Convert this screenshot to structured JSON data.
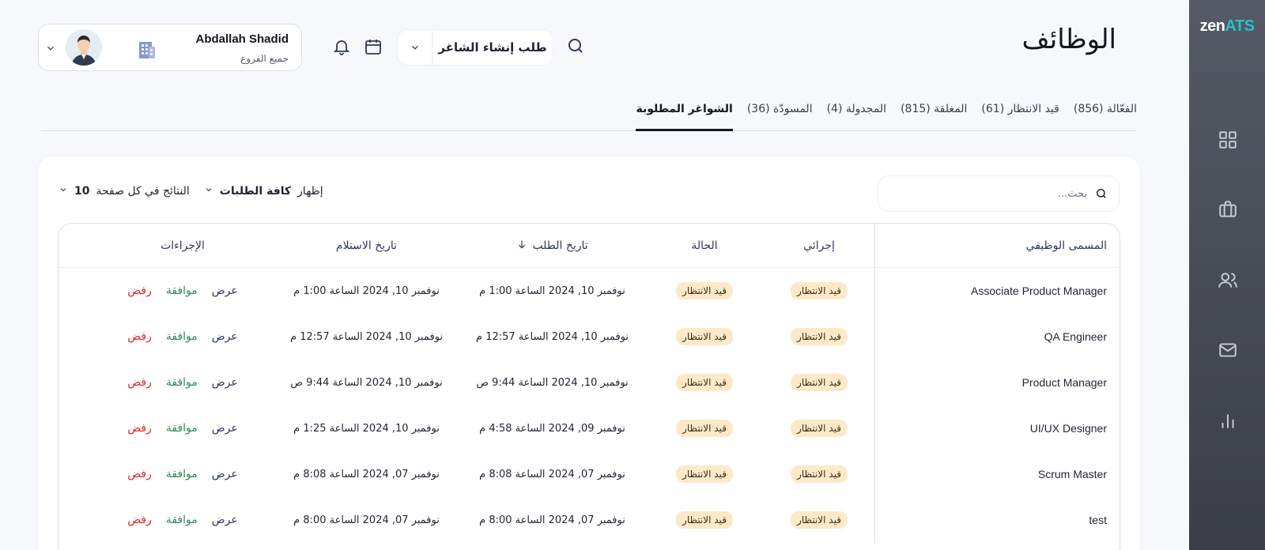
{
  "app": {
    "logo_main": "zen",
    "logo_accent": "ATS",
    "colors": {
      "accent": "#22c3c9",
      "approve": "#2f8a5a",
      "reject": "#e0262a",
      "badge_bg": "#fde9c8"
    }
  },
  "sidebar": {
    "items": [
      {
        "icon": "grid-icon"
      },
      {
        "icon": "briefcase-icon"
      },
      {
        "icon": "users-icon"
      },
      {
        "icon": "mail-icon"
      },
      {
        "icon": "chart-icon"
      }
    ]
  },
  "header": {
    "title": "الوظائف",
    "create_button_label": "طلب إنشاء الشاغر",
    "user": {
      "name": "Abdallah Shadid",
      "branch": "جميع الفروع"
    }
  },
  "tabs": [
    {
      "label": "الفعّالة (856)",
      "active": false
    },
    {
      "label": "قيد الانتظار (61)",
      "active": false
    },
    {
      "label": "المغلقة (815)",
      "active": false
    },
    {
      "label": "المجدولة (4)",
      "active": false
    },
    {
      "label": "المسودّة (36)",
      "active": false
    },
    {
      "label": "الشواغر المطلوبة",
      "active": true
    }
  ],
  "toolbar": {
    "search_placeholder": "بحث...",
    "show_label": "إظهار",
    "show_value": "كافة الطلبات",
    "per_page_label": "النتائج في كل صفحة",
    "per_page_value": "10"
  },
  "table": {
    "headers": {
      "title": "المسمى الوظيفي",
      "procedure": "إجرائي",
      "status": "الحالة",
      "request_date": "تاريخ الطلب",
      "receive_date": "تاريخ الاستلام",
      "actions": "الإجراءات"
    },
    "action_labels": {
      "view": "عرض",
      "approve": "موافقة",
      "reject": "رفض"
    },
    "rows": [
      {
        "title": "Associate Product Manager",
        "procedure": "قيد الانتظار",
        "status": "قيد الانتظار",
        "request_date": "نوفمبر 10, 2024 الساعة 1:00 م",
        "receive_date": "نوفمبر 10, 2024 الساعة 1:00 م"
      },
      {
        "title": "QA Engineer",
        "procedure": "قيد الانتظار",
        "status": "قيد الانتظار",
        "request_date": "نوفمبر 10, 2024 الساعة 12:57 م",
        "receive_date": "نوفمبر 10, 2024 الساعة 12:57 م"
      },
      {
        "title": "Product Manager",
        "procedure": "قيد الانتظار",
        "status": "قيد الانتظار",
        "request_date": "نوفمبر 10, 2024 الساعة 9:44 ص",
        "receive_date": "نوفمبر 10, 2024 الساعة 9:44 ص"
      },
      {
        "title": "UI/UX Designer",
        "procedure": "قيد الانتظار",
        "status": "قيد الانتظار",
        "request_date": "نوفمبر 09, 2024 الساعة 4:58 م",
        "receive_date": "نوفمبر 10, 2024 الساعة 1:25 م"
      },
      {
        "title": "Scrum Master",
        "procedure": "قيد الانتظار",
        "status": "قيد الانتظار",
        "request_date": "نوفمبر 07, 2024 الساعة 8:08 م",
        "receive_date": "نوفمبر 07, 2024 الساعة 8:08 م"
      },
      {
        "title": "test",
        "procedure": "قيد الانتظار",
        "status": "قيد الانتظار",
        "request_date": "نوفمبر 07, 2024 الساعة 8:00 م",
        "receive_date": "نوفمبر 07, 2024 الساعة 8:00 م"
      }
    ]
  }
}
